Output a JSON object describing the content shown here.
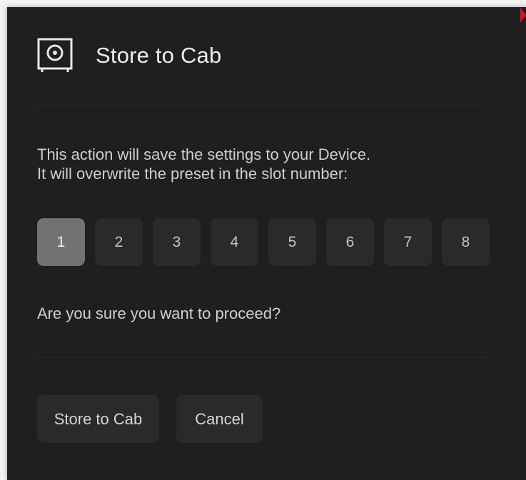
{
  "dialog": {
    "title": "Store to Cab",
    "icon": "cabinet-icon",
    "message_line1": "This action will save the settings to your Device.",
    "message_line2": "It will overwrite the preset in the slot number:",
    "question": "Are you sure you want to proceed?"
  },
  "slots": {
    "selected": "1",
    "items": [
      "1",
      "2",
      "3",
      "4",
      "5",
      "6",
      "7",
      "8"
    ]
  },
  "actions": {
    "confirm_label": "Store to Cab",
    "cancel_label": "Cancel"
  },
  "colors": {
    "dialog_background": "#1f1f1f",
    "slot_background": "#2a2a2a",
    "slot_selected_background": "#727272",
    "corner_marker": "#cc1a1a"
  }
}
